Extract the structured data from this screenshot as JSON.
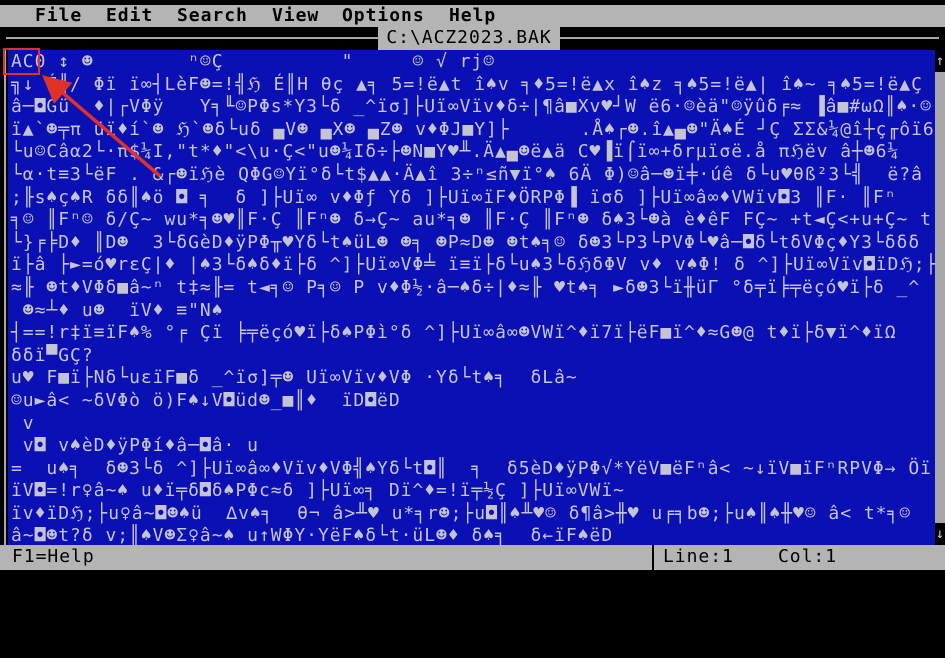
{
  "menu": {
    "items": [
      "File",
      "Edit",
      "Search",
      "View",
      "Options",
      "Help"
    ]
  },
  "window": {
    "title": "C:\\ACZ2023.BAK"
  },
  "editor": {
    "lines": [
      "AC0 ↕ ☻        ⁿ☺Ç          \"     ☺ √ rj☺",
      "╗↓ É║/ Φï ï∞┤LèF☻=!╣ℌ É║H θç ▲╕ 5=!ë▲t î♠v ╕♦5=!ë▲x î♠z ╕♠5=!ë▲| î♠~ ╕♠5=!ë▲Ç",
      "â─◘Gü  ♦|┌VΦÿ   Y╕╙☺PΦs*Y3└δ _^ïσ]├Uï∞Vïv♦δ÷|¶â■Xv♥┘W ë6·☺èä\"☺ÿûδ╒≈ ▐â■#ωΩ║♠·☺",
      "ï▲`☻╤π üï♦í`☻ ℌ`☻δ└uδ ▄V☻ ▄X☻ ▄Z☻ v♦ΦJ■Y]├      .Å♠┌☻.î▲▄☻\"Ä♠É ┘Ç ΣΣ&¼@î┼ç╓ôï6",
      "└u☺Câα2└·π$¼I,\"t*♦\"<\\u·Ç<\"u☻¼Iδ÷├☻N■Y♥╨.Ä▲▄☻ë▲ä C♥▐ï⌠ï∞+δrµïσë.å πℌëv â┼☻6¼",
      "└α·t≡3└ëF . &┌☻ïℌè QΦG☺Yï°δ└t$▲▲·Ä▲î 3÷ⁿ≤ñ▼ï°♠ 6Ä Φ)☺â─☻ï╪·úê δ└u♥θß²3└╣  ë?â",
      ";╟s♠ç♠R δδ║♠ö ◘ ╕  δ ]├Uï∞ v♦Φƒ Yδ ]├Uï∞ïF♦ÖRPΦ▐ ïσδ ]├Uï∞â∞♦VWïv◘3 ║F· ║Fⁿ",
      "╕☺ ║Fⁿ☺ δ/Ç~ wu*╕☻♥║F·Ç ║Fⁿ☻ δ→Ç~ au*╕☻ ║F·Ç ║Fⁿ☻ δ♠3└☻à è♦êF FÇ~ +t◄Ç<+u+Ç~ t",
      "└}╒╞D♦ ║D☻  3└δGèD♦ÿPΦ╥♥Yδ└t♠üL☻ ☻╕ ☻P≈D☻ ☻t♠╕☺ δ☻3└P3└PVΦ└♥â─◘δ└tδVΦç♦Y3└δδδ",
      "ï├â ├►=ó♥rεÇ|♦ |♠3└δ♠δ♦ï├δ ^]├Uï∞VΦ╧ ï≡ï├δ└u♠3└δℌδΦV v♦ v♠Φ! δ ^]├Uï∞Vïv◘ïDℌ;├t♦",
      "≈╟ ☻t♦VΦδ■â~ⁿ t‡≈╟= t◄╕☺ P╕☺ P v♦Φ½·â─♠δ÷|♦≈╟ ♥t♠╕ ►δ☻3└ï╫üΓ °δ╤ï╞╤ëçó♥ï├δ _^",
      " ☻≈┴♦ u☻  ïV♦ ≡\"N♠",
      "┤==!r‡ï≡ïF♠% °╒ Çï ╞╤ëçó♥ï├δ♠PΦì°δ ^]├Uï∞â∞☻VWï^♦ï7ï├ëF■ï^♦≈G☻@ t♦ï├δ▼ï^♦ïΩ",
      "δδï▀GÇ?",
      "u♥ F■ï├Nδ└uεïF■δ _^ïσ]╤☻ Uï∞Vïv♦VΦ ·Yδ└t♠╕  δLâ~",
      "☺u►â< ~δVΦò ö)F♠↓V◘üd☻_■║♦  ïD◘ëD",
      " v",
      " v◘ v♠èD♦ÿPΦí♦â─◘â· u",
      "=  u♠╕  δ☻3└δ ^]├Uï∞â∞♦Vïv♦VΦ╣♠Yδ└t◘║  ╕  δ5èD♦ÿPΦ√*YëV■ëFⁿâ< ~↓ïV■ïFⁿRPVΦ→ Öï",
      "ïV◘=!r♀â~♠ u♦ï╤δ◘δ♠PΦc≈δ ]├Uï∞╕ Dï^♦=!ï╤½Ç ]├Uï∞VWï~",
      "ïv♦ïDℌ;├u♀â~◘☻♠ü  ∆v♠╕  θ¬ â>╨♥ u*╕r☻;├u◘║♠╨♥☺ δ¶â>╫♥ u╒╕b☻;├u♠║♠╫♥☺ â< t*╕☺",
      "â~◘☻t?δ v;║♠V☻Σ♀â~♠ u↑WΦY·YëF♠δ└t·üL☻♦ δ♠╕  δ←ïF♠ëD"
    ]
  },
  "scrollbar": {
    "up_icon": "arrow-up-icon",
    "down_icon": "arrow-down-icon"
  },
  "status": {
    "help": "F1=Help",
    "line": "Line:1",
    "col": "Col:1"
  },
  "annotation": {
    "color": "#e0302a"
  },
  "colors": {
    "editor_bg": "#0a10b4",
    "editor_fg": "#c4c4d4",
    "bar_bg": "#b4b4b4"
  }
}
